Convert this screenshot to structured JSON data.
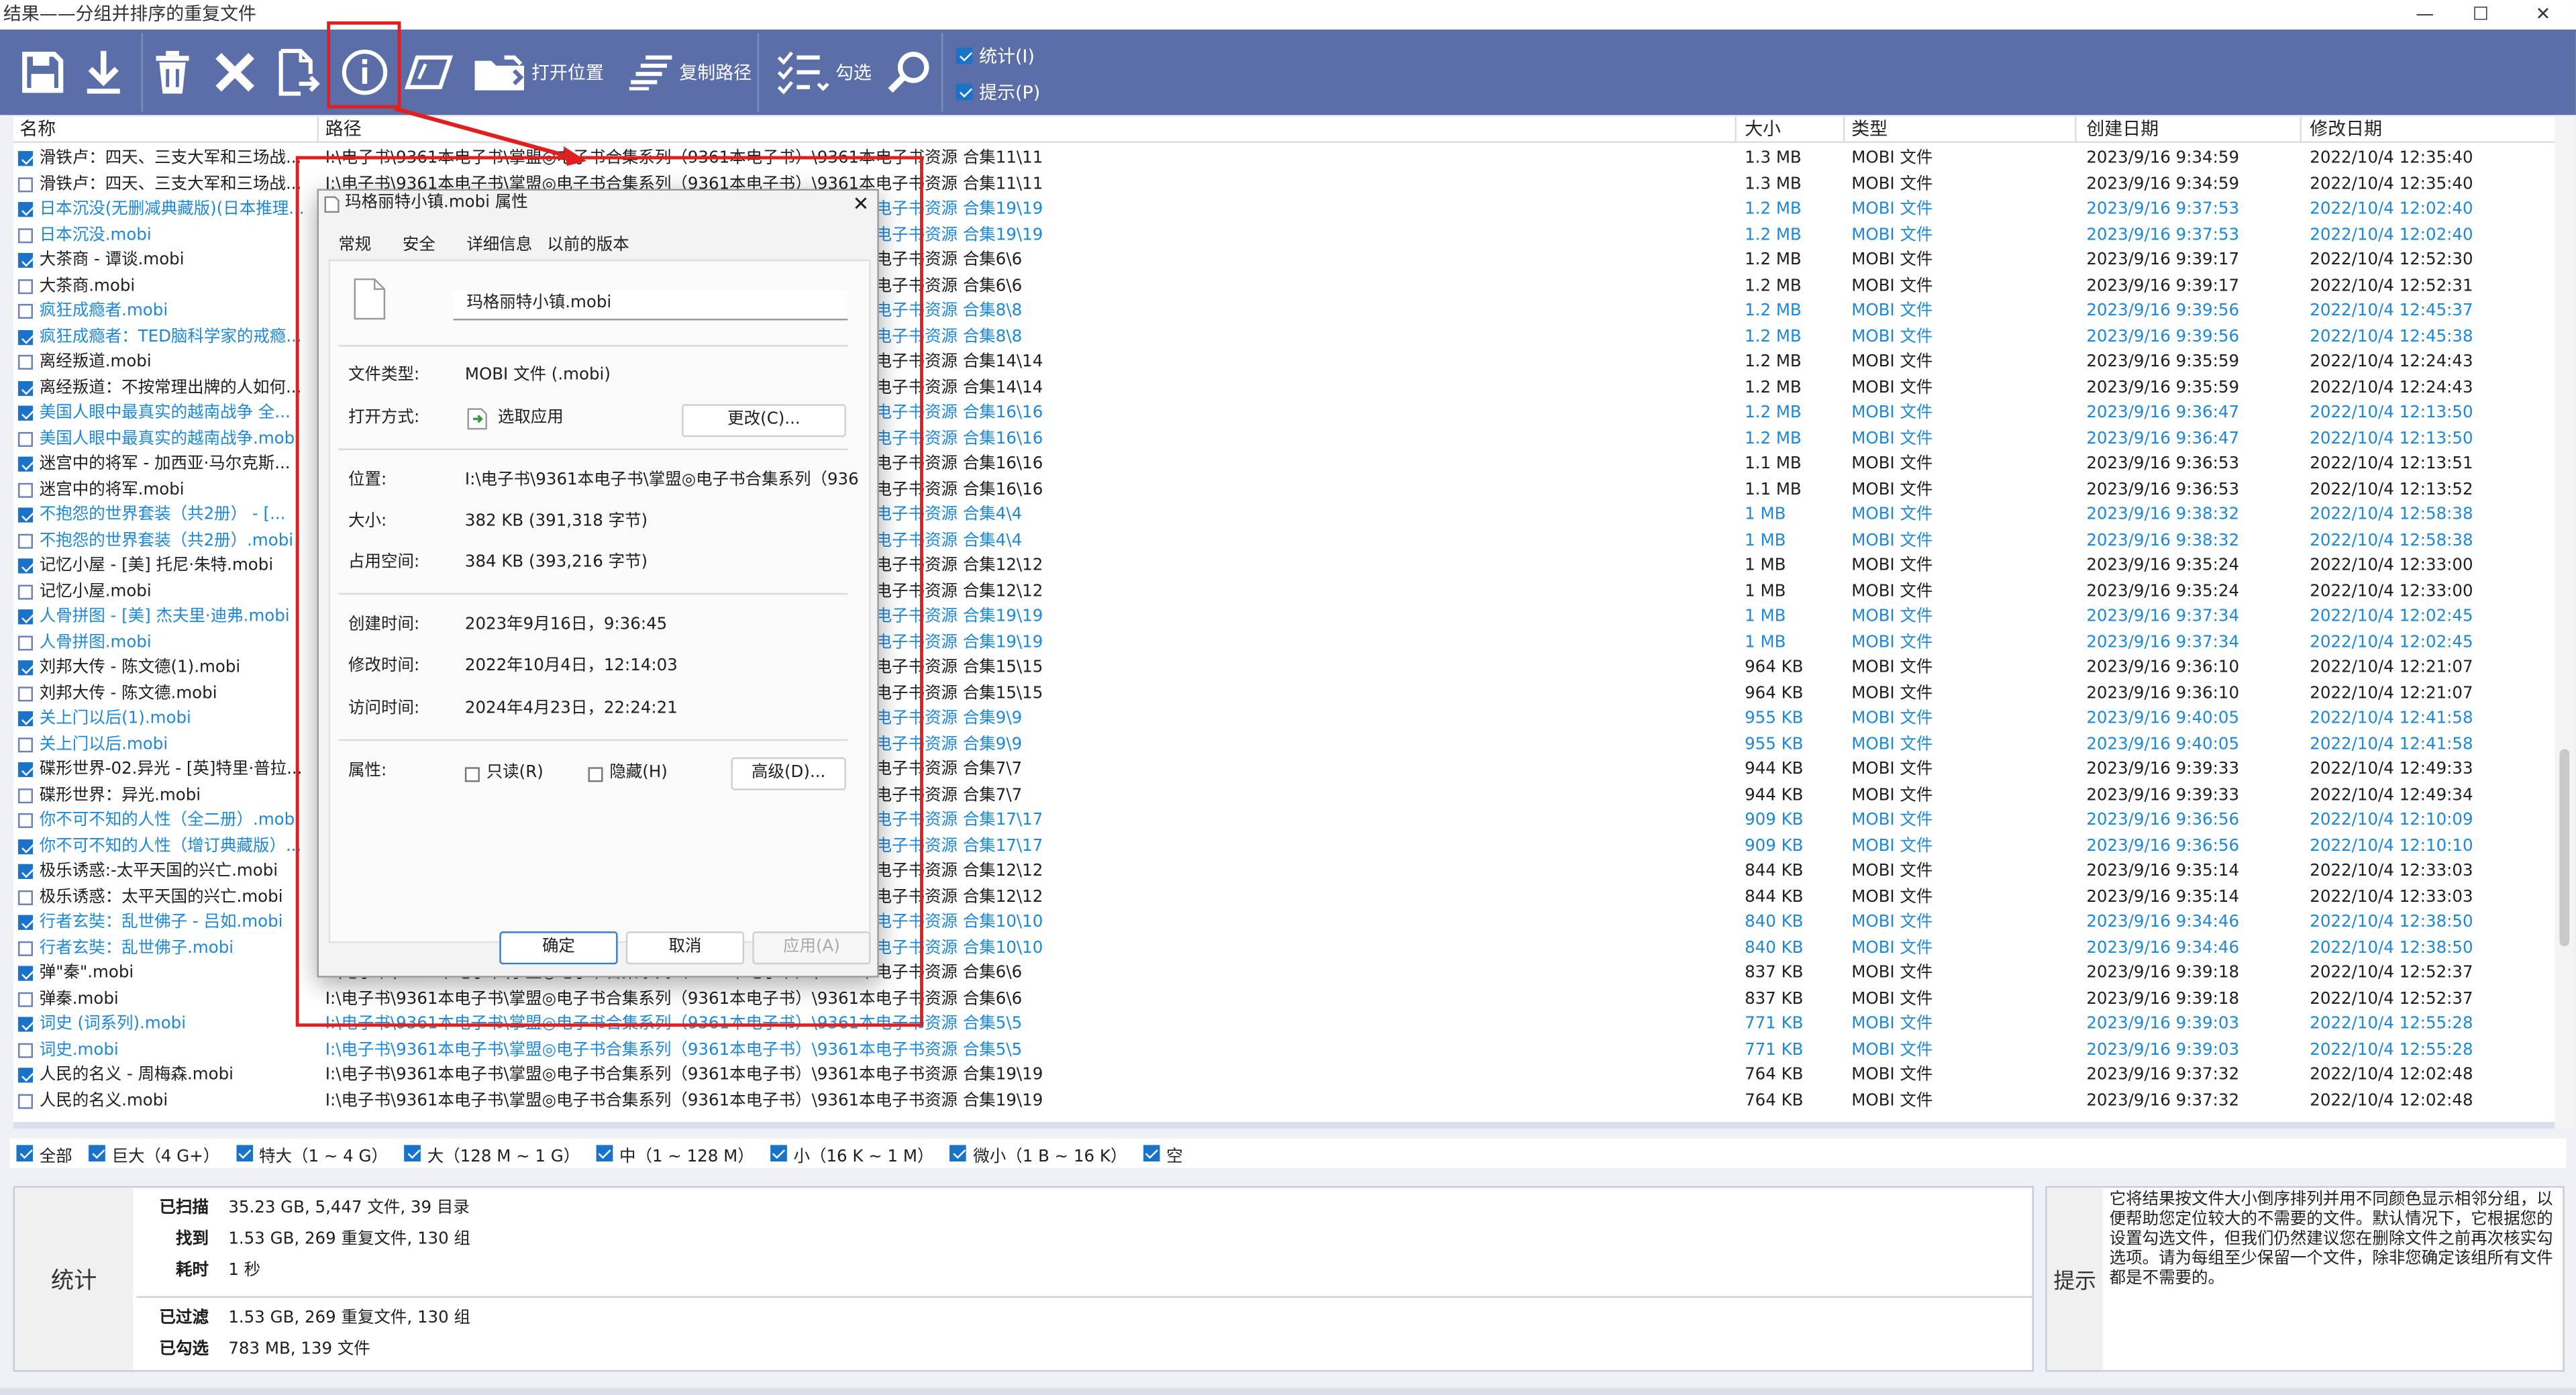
{
  "window": {
    "title": "结果——分组并排序的重复文件",
    "minimize": "—",
    "maximize": "☐",
    "close": "✕"
  },
  "toolbar": {
    "open_location": "打开位置",
    "copy_path": "复制路径",
    "select": "勾选",
    "stats_label": "统计(I)",
    "tips_label": "提示(P)"
  },
  "columns": [
    "名称",
    "路径",
    "大小",
    "类型",
    "创建日期",
    "修改日期"
  ],
  "rows": [
    {
      "checked": true,
      "blue": false,
      "name": "滑铁卢：四天、三支大军和三场战...",
      "path": "I:\\电子书\\9361本电子书\\掌盟◎电子书合集系列（9361本电子书）\\9361本电子书资源 合集11\\11",
      "size": "1.3 MB",
      "type": "MOBI 文件",
      "created": "2023/9/16 9:34:59",
      "modified": "2022/10/4 12:35:40"
    },
    {
      "checked": false,
      "blue": false,
      "name": "滑铁卢：四天、三支大军和三场战...",
      "path": "I:\\电子书\\9361本电子书\\掌盟◎电子书合集系列（9361本电子书）\\9361本电子书资源 合集11\\11",
      "size": "1.3 MB",
      "type": "MOBI 文件",
      "created": "2023/9/16 9:34:59",
      "modified": "2022/10/4 12:35:40"
    },
    {
      "checked": true,
      "blue": true,
      "name": "日本沉没(无删减典藏版)(日本推理...",
      "path": "I:\\电子书\\9361本电子书\\掌盟◎电子书合集系列（9361本电子书）\\9361本电子书资源 合集19\\19",
      "size": "1.2 MB",
      "type": "MOBI 文件",
      "created": "2023/9/16 9:37:53",
      "modified": "2022/10/4 12:02:40"
    },
    {
      "checked": false,
      "blue": true,
      "name": "日本沉没.mobi",
      "path": "I:\\电子书\\9361本电子书\\掌盟◎电子书合集系列（9361本电子书）\\9361本电子书资源 合集19\\19",
      "size": "1.2 MB",
      "type": "MOBI 文件",
      "created": "2023/9/16 9:37:53",
      "modified": "2022/10/4 12:02:40"
    },
    {
      "checked": true,
      "blue": false,
      "name": "大茶商 - 谭谈.mobi",
      "path": "I:\\电子书\\9361本电子书\\掌盟◎电子书合集系列（9361本电子书）\\9361本电子书资源 合集6\\6",
      "size": "1.2 MB",
      "type": "MOBI 文件",
      "created": "2023/9/16 9:39:17",
      "modified": "2022/10/4 12:52:30"
    },
    {
      "checked": false,
      "blue": false,
      "name": "大茶商.mobi",
      "path": "I:\\电子书\\9361本电子书\\掌盟◎电子书合集系列（9361本电子书）\\9361本电子书资源 合集6\\6",
      "size": "1.2 MB",
      "type": "MOBI 文件",
      "created": "2023/9/16 9:39:17",
      "modified": "2022/10/4 12:52:31"
    },
    {
      "checked": false,
      "blue": true,
      "name": "疯狂成瘾者.mobi",
      "path": "I:\\电子书\\9361本电子书\\掌盟◎电子书合集系列（9361本电子书）\\9361本电子书资源 合集8\\8",
      "size": "1.2 MB",
      "type": "MOBI 文件",
      "created": "2023/9/16 9:39:56",
      "modified": "2022/10/4 12:45:37"
    },
    {
      "checked": true,
      "blue": true,
      "name": "疯狂成瘾者：TED脑科学家的戒瘾...",
      "path": "I:\\电子书\\9361本电子书\\掌盟◎电子书合集系列（9361本电子书）\\9361本电子书资源 合集8\\8",
      "size": "1.2 MB",
      "type": "MOBI 文件",
      "created": "2023/9/16 9:39:56",
      "modified": "2022/10/4 12:45:38"
    },
    {
      "checked": false,
      "blue": false,
      "name": "离经叛道.mobi",
      "path": "I:\\电子书\\9361本电子书\\掌盟◎电子书合集系列（9361本电子书）\\9361本电子书资源 合集14\\14",
      "size": "1.2 MB",
      "type": "MOBI 文件",
      "created": "2023/9/16 9:35:59",
      "modified": "2022/10/4 12:24:43"
    },
    {
      "checked": true,
      "blue": false,
      "name": "离经叛道：不按常理出牌的人如何...",
      "path": "I:\\电子书\\9361本电子书\\掌盟◎电子书合集系列（9361本电子书）\\9361本电子书资源 合集14\\14",
      "size": "1.2 MB",
      "type": "MOBI 文件",
      "created": "2023/9/16 9:35:59",
      "modified": "2022/10/4 12:24:43"
    },
    {
      "checked": true,
      "blue": true,
      "name": "美国人眼中最真实的越南战争 全...",
      "path": "I:\\电子书\\9361本电子书\\掌盟◎电子书合集系列（9361本电子书）\\9361本电子书资源 合集16\\16",
      "size": "1.2 MB",
      "type": "MOBI 文件",
      "created": "2023/9/16 9:36:47",
      "modified": "2022/10/4 12:13:50"
    },
    {
      "checked": false,
      "blue": true,
      "name": "美国人眼中最真实的越南战争.mobi",
      "path": "I:\\电子书\\9361本电子书\\掌盟◎电子书合集系列（9361本电子书）\\9361本电子书资源 合集16\\16",
      "size": "1.2 MB",
      "type": "MOBI 文件",
      "created": "2023/9/16 9:36:47",
      "modified": "2022/10/4 12:13:50"
    },
    {
      "checked": true,
      "blue": false,
      "name": "迷宫中的将军 - 加西亚·马尔克斯...",
      "path": "I:\\电子书\\9361本电子书\\掌盟◎电子书合集系列（9361本电子书）\\9361本电子书资源 合集16\\16",
      "size": "1.1 MB",
      "type": "MOBI 文件",
      "created": "2023/9/16 9:36:53",
      "modified": "2022/10/4 12:13:51"
    },
    {
      "checked": false,
      "blue": false,
      "name": "迷宫中的将军.mobi",
      "path": "I:\\电子书\\9361本电子书\\掌盟◎电子书合集系列（9361本电子书）\\9361本电子书资源 合集16\\16",
      "size": "1.1 MB",
      "type": "MOBI 文件",
      "created": "2023/9/16 9:36:53",
      "modified": "2022/10/4 12:13:52"
    },
    {
      "checked": true,
      "blue": true,
      "name": "不抱怨的世界套装（共2册） - [...",
      "path": "I:\\电子书\\9361本电子书\\掌盟◎电子书合集系列（9361本电子书）\\9361本电子书资源 合集4\\4",
      "size": "1 MB",
      "type": "MOBI 文件",
      "created": "2023/9/16 9:38:32",
      "modified": "2022/10/4 12:58:38"
    },
    {
      "checked": false,
      "blue": true,
      "name": "不抱怨的世界套装（共2册）.mobi",
      "path": "I:\\电子书\\9361本电子书\\掌盟◎电子书合集系列（9361本电子书）\\9361本电子书资源 合集4\\4",
      "size": "1 MB",
      "type": "MOBI 文件",
      "created": "2023/9/16 9:38:32",
      "modified": "2022/10/4 12:58:38"
    },
    {
      "checked": true,
      "blue": false,
      "name": "记忆小屋 - [美] 托尼·朱特.mobi",
      "path": "I:\\电子书\\9361本电子书\\掌盟◎电子书合集系列（9361本电子书）\\9361本电子书资源 合集12\\12",
      "size": "1 MB",
      "type": "MOBI 文件",
      "created": "2023/9/16 9:35:24",
      "modified": "2022/10/4 12:33:00"
    },
    {
      "checked": false,
      "blue": false,
      "name": "记忆小屋.mobi",
      "path": "I:\\电子书\\9361本电子书\\掌盟◎电子书合集系列（9361本电子书）\\9361本电子书资源 合集12\\12",
      "size": "1 MB",
      "type": "MOBI 文件",
      "created": "2023/9/16 9:35:24",
      "modified": "2022/10/4 12:33:00"
    },
    {
      "checked": true,
      "blue": true,
      "name": "人骨拼图 - [美] 杰夫里·迪弗.mobi",
      "path": "I:\\电子书\\9361本电子书\\掌盟◎电子书合集系列（9361本电子书）\\9361本电子书资源 合集19\\19",
      "size": "1 MB",
      "type": "MOBI 文件",
      "created": "2023/9/16 9:37:34",
      "modified": "2022/10/4 12:02:45"
    },
    {
      "checked": false,
      "blue": true,
      "name": "人骨拼图.mobi",
      "path": "I:\\电子书\\9361本电子书\\掌盟◎电子书合集系列（9361本电子书）\\9361本电子书资源 合集19\\19",
      "size": "1 MB",
      "type": "MOBI 文件",
      "created": "2023/9/16 9:37:34",
      "modified": "2022/10/4 12:02:45"
    },
    {
      "checked": true,
      "blue": false,
      "name": "刘邦大传 - 陈文德(1).mobi",
      "path": "I:\\电子书\\9361本电子书\\掌盟◎电子书合集系列（9361本电子书）\\9361本电子书资源 合集15\\15",
      "size": "964 KB",
      "type": "MOBI 文件",
      "created": "2023/9/16 9:36:10",
      "modified": "2022/10/4 12:21:07"
    },
    {
      "checked": false,
      "blue": false,
      "name": "刘邦大传 - 陈文德.mobi",
      "path": "I:\\电子书\\9361本电子书\\掌盟◎电子书合集系列（9361本电子书）\\9361本电子书资源 合集15\\15",
      "size": "964 KB",
      "type": "MOBI 文件",
      "created": "2023/9/16 9:36:10",
      "modified": "2022/10/4 12:21:07"
    },
    {
      "checked": true,
      "blue": true,
      "name": "关上门以后(1).mobi",
      "path": "I:\\电子书\\9361本电子书\\掌盟◎电子书合集系列（9361本电子书）\\9361本电子书资源 合集9\\9",
      "size": "955 KB",
      "type": "MOBI 文件",
      "created": "2023/9/16 9:40:05",
      "modified": "2022/10/4 12:41:58"
    },
    {
      "checked": false,
      "blue": true,
      "name": "关上门以后.mobi",
      "path": "I:\\电子书\\9361本电子书\\掌盟◎电子书合集系列（9361本电子书）\\9361本电子书资源 合集9\\9",
      "size": "955 KB",
      "type": "MOBI 文件",
      "created": "2023/9/16 9:40:05",
      "modified": "2022/10/4 12:41:58"
    },
    {
      "checked": true,
      "blue": false,
      "name": "碟形世界-02.异光 - [英]特里·普拉...",
      "path": "I:\\电子书\\9361本电子书\\掌盟◎电子书合集系列（9361本电子书）\\9361本电子书资源 合集7\\7",
      "size": "944 KB",
      "type": "MOBI 文件",
      "created": "2023/9/16 9:39:33",
      "modified": "2022/10/4 12:49:33"
    },
    {
      "checked": false,
      "blue": false,
      "name": "碟形世界：异光.mobi",
      "path": "I:\\电子书\\9361本电子书\\掌盟◎电子书合集系列（9361本电子书）\\9361本电子书资源 合集7\\7",
      "size": "944 KB",
      "type": "MOBI 文件",
      "created": "2023/9/16 9:39:33",
      "modified": "2022/10/4 12:49:34"
    },
    {
      "checked": false,
      "blue": true,
      "name": "你不可不知的人性（全二册）.mobi",
      "path": "I:\\电子书\\9361本电子书\\掌盟◎电子书合集系列（9361本电子书）\\9361本电子书资源 合集17\\17",
      "size": "909 KB",
      "type": "MOBI 文件",
      "created": "2023/9/16 9:36:56",
      "modified": "2022/10/4 12:10:09"
    },
    {
      "checked": true,
      "blue": true,
      "name": "你不可不知的人性（增订典藏版）...",
      "path": "I:\\电子书\\9361本电子书\\掌盟◎电子书合集系列（9361本电子书）\\9361本电子书资源 合集17\\17",
      "size": "909 KB",
      "type": "MOBI 文件",
      "created": "2023/9/16 9:36:56",
      "modified": "2022/10/4 12:10:10"
    },
    {
      "checked": true,
      "blue": false,
      "name": "极乐诱惑:-太平天国的兴亡.mobi",
      "path": "I:\\电子书\\9361本电子书\\掌盟◎电子书合集系列（9361本电子书）\\9361本电子书资源 合集12\\12",
      "size": "844 KB",
      "type": "MOBI 文件",
      "created": "2023/9/16 9:35:14",
      "modified": "2022/10/4 12:33:03"
    },
    {
      "checked": false,
      "blue": false,
      "name": "极乐诱惑：太平天国的兴亡.mobi",
      "path": "I:\\电子书\\9361本电子书\\掌盟◎电子书合集系列（9361本电子书）\\9361本电子书资源 合集12\\12",
      "size": "844 KB",
      "type": "MOBI 文件",
      "created": "2023/9/16 9:35:14",
      "modified": "2022/10/4 12:33:03"
    },
    {
      "checked": true,
      "blue": true,
      "name": "行者玄奘：乱世佛子 - 吕如.mobi",
      "path": "I:\\电子书\\9361本电子书\\掌盟◎电子书合集系列（9361本电子书）\\9361本电子书资源 合集10\\10",
      "size": "840 KB",
      "type": "MOBI 文件",
      "created": "2023/9/16 9:34:46",
      "modified": "2022/10/4 12:38:50"
    },
    {
      "checked": false,
      "blue": true,
      "name": "行者玄奘：乱世佛子.mobi",
      "path": "I:\\电子书\\9361本电子书\\掌盟◎电子书合集系列（9361本电子书）\\9361本电子书资源 合集10\\10",
      "size": "840 KB",
      "type": "MOBI 文件",
      "created": "2023/9/16 9:34:46",
      "modified": "2022/10/4 12:38:50"
    },
    {
      "checked": true,
      "blue": false,
      "name": "弹\"秦\".mobi",
      "path": "I:\\电子书\\9361本电子书\\掌盟◎电子书合集系列（9361本电子书）\\9361本电子书资源 合集6\\6",
      "size": "837 KB",
      "type": "MOBI 文件",
      "created": "2023/9/16 9:39:18",
      "modified": "2022/10/4 12:52:37"
    },
    {
      "checked": false,
      "blue": false,
      "name": "弹秦.mobi",
      "path": "I:\\电子书\\9361本电子书\\掌盟◎电子书合集系列（9361本电子书）\\9361本电子书资源 合集6\\6",
      "size": "837 KB",
      "type": "MOBI 文件",
      "created": "2023/9/16 9:39:18",
      "modified": "2022/10/4 12:52:37"
    },
    {
      "checked": true,
      "blue": true,
      "name": "词史 (词系列).mobi",
      "path": "I:\\电子书\\9361本电子书\\掌盟◎电子书合集系列（9361本电子书）\\9361本电子书资源 合集5\\5",
      "size": "771 KB",
      "type": "MOBI 文件",
      "created": "2023/9/16 9:39:03",
      "modified": "2022/10/4 12:55:28"
    },
    {
      "checked": false,
      "blue": true,
      "name": "词史.mobi",
      "path": "I:\\电子书\\9361本电子书\\掌盟◎电子书合集系列（9361本电子书）\\9361本电子书资源 合集5\\5",
      "size": "771 KB",
      "type": "MOBI 文件",
      "created": "2023/9/16 9:39:03",
      "modified": "2022/10/4 12:55:28"
    },
    {
      "checked": true,
      "blue": false,
      "name": "人民的名义 - 周梅森.mobi",
      "path": "I:\\电子书\\9361本电子书\\掌盟◎电子书合集系列（9361本电子书）\\9361本电子书资源 合集19\\19",
      "size": "764 KB",
      "type": "MOBI 文件",
      "created": "2023/9/16 9:37:32",
      "modified": "2022/10/4 12:02:48"
    },
    {
      "checked": false,
      "blue": false,
      "name": "人民的名义.mobi",
      "path": "I:\\电子书\\9361本电子书\\掌盟◎电子书合集系列（9361本电子书）\\9361本电子书资源 合集19\\19",
      "size": "764 KB",
      "type": "MOBI 文件",
      "created": "2023/9/16 9:37:32",
      "modified": "2022/10/4 12:02:48"
    }
  ],
  "filters": [
    {
      "label": "全部",
      "checked": true
    },
    {
      "label": "巨大（4 G+）",
      "checked": true
    },
    {
      "label": "特大（1 ~ 4 G）",
      "checked": true
    },
    {
      "label": "大（128 M ~ 1 G）",
      "checked": true
    },
    {
      "label": "中（1 ~ 128 M）",
      "checked": true
    },
    {
      "label": "小（16 K ~ 1 M）",
      "checked": true
    },
    {
      "label": "微小（1 B ~ 16 K）",
      "checked": true
    },
    {
      "label": "空",
      "checked": true
    }
  ],
  "stats": {
    "label": "统计",
    "scanned_label": "已扫描",
    "scanned": "35.23 GB, 5,447 文件, 39 目录",
    "found_label": "找到",
    "found": "1.53 GB, 269 重复文件, 130 组",
    "elapsed_label": "耗时",
    "elapsed": "1 秒",
    "filtered_label": "已过滤",
    "filtered": "1.53 GB, 269 重复文件, 130 组",
    "selected_label": "已勾选",
    "selected": "783 MB, 139 文件"
  },
  "tips": {
    "label": "提示",
    "text": "它将结果按文件大小倒序排列并用不同颜色显示相邻分组，以便帮助您定位较大的不需要的文件。默认情况下，它根据您的设置勾选文件，但我们仍然建议您在删除文件之前再次核实勾选项。请为每组至少保留一个文件，除非您确定该组所有文件都是不需要的。"
  },
  "dialog": {
    "title": "玛格丽特小镇.mobi 属性",
    "close": "✕",
    "tabs": [
      "常规",
      "安全",
      "详细信息",
      "以前的版本"
    ],
    "filename": "玛格丽特小镇.mobi",
    "type_label": "文件类型:",
    "type_value": "MOBI 文件 (.mobi)",
    "open_label": "打开方式:",
    "open_value": "选取应用",
    "change_btn": "更改(C)...",
    "location_label": "位置:",
    "location_value": "I:\\电子书\\9361本电子书\\掌盟◎电子书合集系列（936",
    "size_label": "大小:",
    "size_value": "382 KB (391,318 字节)",
    "disk_label": "占用空间:",
    "disk_value": "384 KB (393,216 字节)",
    "created_label": "创建时间:",
    "created_value": "2023年9月16日，9:36:45",
    "modified_label": "修改时间:",
    "modified_value": "2022年10月4日，12:14:03",
    "accessed_label": "访问时间:",
    "accessed_value": "2024年4月23日，22:24:21",
    "attr_label": "属性:",
    "readonly": "只读(R)",
    "hidden": "隐藏(H)",
    "advanced_btn": "高级(D)...",
    "ok": "确定",
    "cancel": "取消",
    "apply": "应用(A)"
  },
  "colors": {
    "toolbar": "#5b6ea8",
    "accent_blue": "#1e88d8",
    "annotation_red": "#e02020"
  }
}
